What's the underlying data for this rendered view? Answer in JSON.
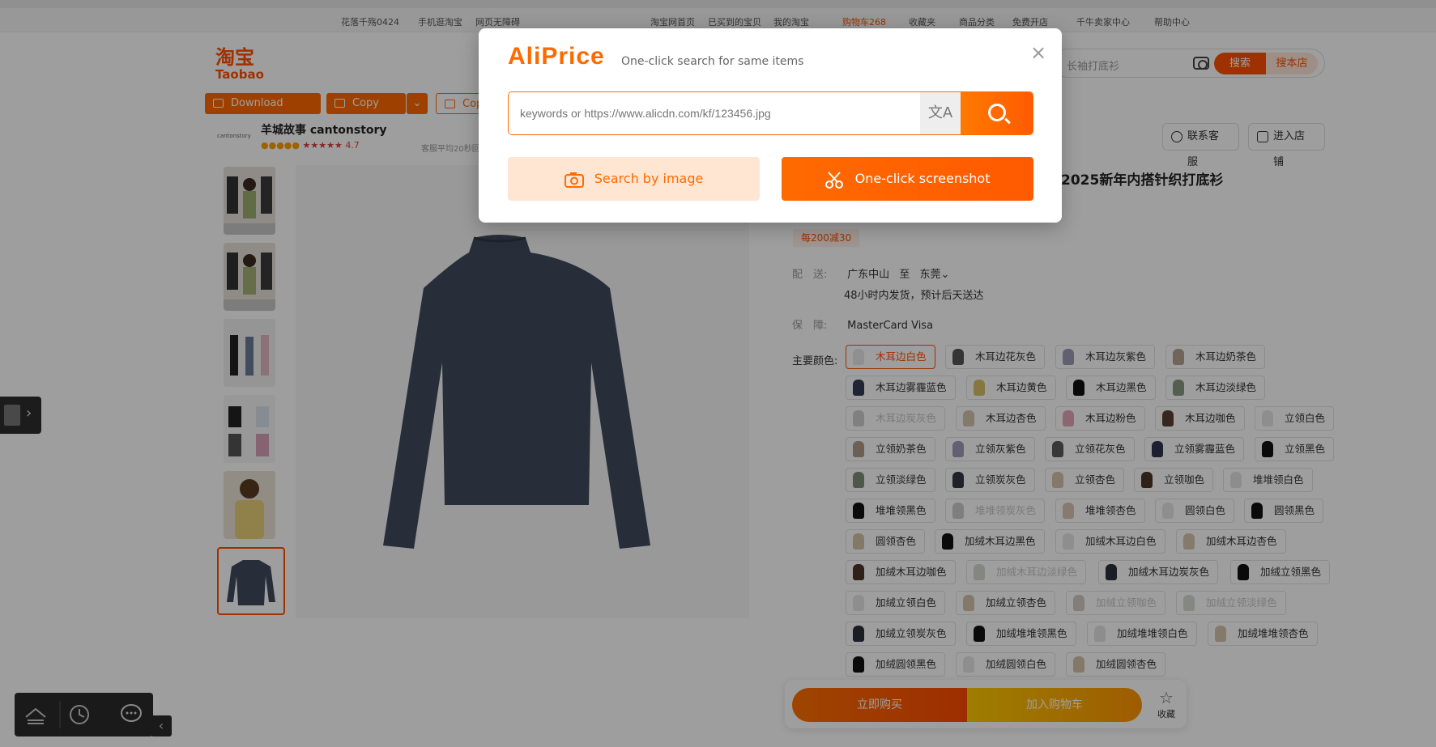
{
  "topbar": {
    "left": [
      "花落千殇0424",
      "手机逛淘宝",
      "网页无障碍"
    ],
    "right": [
      "淘宝网首页",
      "已买到的宝贝",
      "我的淘宝",
      "购物车268",
      "收藏夹",
      "商品分类",
      "免费开店",
      "千牛卖家中心",
      "帮助中心"
    ]
  },
  "logo": {
    "cn": "淘宝",
    "en": "Taobao"
  },
  "search": {
    "placeholder": "长袖打底衫",
    "btn_search": "搜索",
    "btn_shop": "搜本店"
  },
  "toolbar": {
    "download": "Download image",
    "copy": "Copy link",
    "copy_more": "Cop"
  },
  "shop": {
    "logo_text": "cantonstory",
    "name": "羊城故事 cantonstory",
    "score": "4.7",
    "sub": "客服平均20秒回"
  },
  "service": {
    "contact": "联系客服",
    "enter_shop": "进入店铺"
  },
  "product": {
    "title": "2025新年内搭针织打底衫",
    "promo": "每200减30",
    "ship_label": "配　送:",
    "ship_from": "广东中山",
    "ship_to_word": "至",
    "ship_to": "东莞",
    "ship_note": "48小时内发货，预计后天送达",
    "guarantee_label": "保　障:",
    "guarantee": "MasterCard Visa",
    "color_label": "主要颜色:"
  },
  "colors": [
    {
      "name": "木耳边白色",
      "state": "selected",
      "chip": "#e9e9e9"
    },
    {
      "name": "木耳边花灰色",
      "state": "normal",
      "chip": "#555555"
    },
    {
      "name": "木耳边灰紫色",
      "state": "normal",
      "chip": "#9c9bb8"
    },
    {
      "name": "木耳边奶茶色",
      "state": "normal",
      "chip": "#b7a290"
    },
    {
      "name": "木耳边雾霾蓝色",
      "state": "normal",
      "chip": "#353c58"
    },
    {
      "name": "木耳边黄色",
      "state": "normal",
      "chip": "#d8c16a"
    },
    {
      "name": "木耳边黑色",
      "state": "normal",
      "chip": "#111111"
    },
    {
      "name": "木耳边淡绿色",
      "state": "normal",
      "chip": "#8a9a80"
    },
    {
      "name": "木耳边炭灰色",
      "state": "disabled",
      "chip": "#cfcfcf"
    },
    {
      "name": "木耳边杏色",
      "state": "normal",
      "chip": "#d6c6ae"
    },
    {
      "name": "木耳边粉色",
      "state": "normal",
      "chip": "#e2a6b8"
    },
    {
      "name": "木耳边咖色",
      "state": "normal",
      "chip": "#5a4033"
    },
    {
      "name": "立领白色",
      "state": "normal",
      "chip": "#e6e6e6"
    },
    {
      "name": "立领奶茶色",
      "state": "normal",
      "chip": "#b09a88"
    },
    {
      "name": "立领灰紫色",
      "state": "normal",
      "chip": "#a09cbc"
    },
    {
      "name": "立领花灰色",
      "state": "normal",
      "chip": "#5b5b5b"
    },
    {
      "name": "立领雾霾蓝色",
      "state": "normal",
      "chip": "#2f3550"
    },
    {
      "name": "立领黑色",
      "state": "normal",
      "chip": "#111111"
    },
    {
      "name": "立领淡绿色",
      "state": "normal",
      "chip": "#7f8f76"
    },
    {
      "name": "立领炭灰色",
      "state": "normal",
      "chip": "#333844"
    },
    {
      "name": "立领杏色",
      "state": "normal",
      "chip": "#d5c4ab"
    },
    {
      "name": "立领咖色",
      "state": "normal",
      "chip": "#4d3528"
    },
    {
      "name": "堆堆领白色",
      "state": "normal",
      "chip": "#e4e4e4"
    },
    {
      "name": "堆堆领黑色",
      "state": "normal",
      "chip": "#121212"
    },
    {
      "name": "堆堆领炭灰色",
      "state": "disabled",
      "chip": "#cccccc"
    },
    {
      "name": "堆堆领杏色",
      "state": "normal",
      "chip": "#d8c7ae"
    },
    {
      "name": "圆领白色",
      "state": "normal",
      "chip": "#e5e5e5"
    },
    {
      "name": "圆领黑色",
      "state": "normal",
      "chip": "#111111"
    },
    {
      "name": "圆领杏色",
      "state": "normal",
      "chip": "#d5c3a9"
    },
    {
      "name": "加绒木耳边黑色",
      "state": "normal",
      "chip": "#111111"
    },
    {
      "name": "加绒木耳边白色",
      "state": "normal",
      "chip": "#e6e6e6"
    },
    {
      "name": "加绒木耳边杏色",
      "state": "normal",
      "chip": "#d7c6ad"
    },
    {
      "name": "加绒木耳边咖色",
      "state": "normal",
      "chip": "#4d3528"
    },
    {
      "name": "加绒木耳边淡绿色",
      "state": "disabled",
      "chip": "#d4d9d0"
    },
    {
      "name": "加绒木耳边炭灰色",
      "state": "normal",
      "chip": "#2d2f3a"
    },
    {
      "name": "加绒立领黑色",
      "state": "normal",
      "chip": "#111111"
    },
    {
      "name": "加绒立领白色",
      "state": "normal",
      "chip": "#e6e6e6"
    },
    {
      "name": "加绒立领杏色",
      "state": "normal",
      "chip": "#d5c3a9"
    },
    {
      "name": "加绒立领咖色",
      "state": "disabled",
      "chip": "#d2cbc6"
    },
    {
      "name": "加绒立领淡绿色",
      "state": "disabled",
      "chip": "#d6dad2"
    },
    {
      "name": "加绒立领炭灰色",
      "state": "normal",
      "chip": "#2d2f3a"
    },
    {
      "name": "加绒堆堆领黑色",
      "state": "normal",
      "chip": "#111111"
    },
    {
      "name": "加绒堆堆领白色",
      "state": "normal",
      "chip": "#e4e4e4"
    },
    {
      "name": "加绒堆堆领杏色",
      "state": "normal",
      "chip": "#d5c4ab"
    },
    {
      "name": "加绒圆领黑色",
      "state": "normal",
      "chip": "#111111"
    },
    {
      "name": "加绒圆领白色",
      "state": "normal",
      "chip": "#e6e6e6"
    },
    {
      "name": "加绒圆领杏色",
      "state": "normal",
      "chip": "#d5c3a9"
    }
  ],
  "actions": {
    "buy": "立即购买",
    "cart": "加入购物车",
    "fav": "收藏"
  },
  "aliprice": {
    "brand": "AliPrice",
    "tagline": "One-click search for same items",
    "input_placeholder": "keywords or https://www.alicdn.com/kf/123456.jpg",
    "translate_glyph": "文A",
    "btn_image": "Search by image",
    "btn_screenshot": "One-click screenshot",
    "close": "×"
  },
  "colors_theme": {
    "brand": "#ff5000",
    "aliprice": "#ff6a00"
  }
}
